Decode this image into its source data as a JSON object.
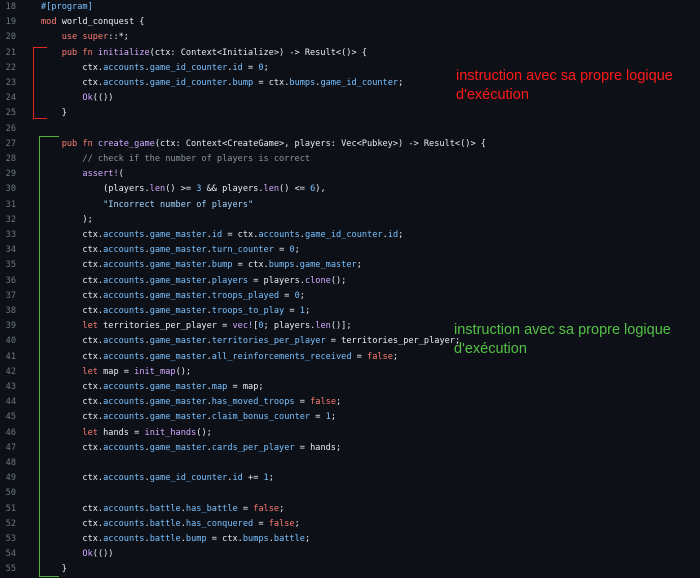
{
  "colors": {
    "background": "#0d1117",
    "line_number": "#6e7681",
    "keyword": "#ff7b72",
    "function": "#d2a8ff",
    "property": "#79c0ff",
    "string": "#a5d6ff",
    "comment": "#8b949e",
    "red_annotation": "#ff1a1a",
    "green_annotation": "#55c046"
  },
  "annotations": {
    "red": "instruction avec sa propre logique d'exécution",
    "green": "instruction avec sa propre logique d'exécution"
  },
  "lines": [
    {
      "n": "18",
      "tokens": [
        [
          "attr",
          "#[program]"
        ]
      ]
    },
    {
      "n": "19",
      "tokens": [
        [
          "kw",
          "mod "
        ],
        [
          "plain",
          "world_conquest {"
        ]
      ]
    },
    {
      "n": "20",
      "tokens": [
        [
          "plain",
          "    "
        ],
        [
          "kw",
          "use "
        ],
        [
          "kw",
          "super"
        ],
        [
          "plain",
          "::*;"
        ]
      ]
    },
    {
      "n": "21",
      "tokens": [
        [
          "plain",
          "    "
        ],
        [
          "kw",
          "pub fn "
        ],
        [
          "fn",
          "initialize"
        ],
        [
          "plain",
          "(ctx: Context<Initialize>) -> Result<()> {"
        ]
      ]
    },
    {
      "n": "22",
      "tokens": [
        [
          "plain",
          "        ctx."
        ],
        [
          "prop",
          "accounts"
        ],
        [
          "plain",
          "."
        ],
        [
          "prop",
          "game_id_counter"
        ],
        [
          "plain",
          "."
        ],
        [
          "prop",
          "id"
        ],
        [
          "plain",
          " = "
        ],
        [
          "num",
          "0"
        ],
        [
          "plain",
          ";"
        ]
      ]
    },
    {
      "n": "23",
      "tokens": [
        [
          "plain",
          "        ctx."
        ],
        [
          "prop",
          "accounts"
        ],
        [
          "plain",
          "."
        ],
        [
          "prop",
          "game_id_counter"
        ],
        [
          "plain",
          "."
        ],
        [
          "prop",
          "bump"
        ],
        [
          "plain",
          " = ctx."
        ],
        [
          "prop",
          "bumps"
        ],
        [
          "plain",
          "."
        ],
        [
          "prop",
          "game_id_counter"
        ],
        [
          "plain",
          ";"
        ]
      ]
    },
    {
      "n": "24",
      "tokens": [
        [
          "plain",
          "        "
        ],
        [
          "fn",
          "Ok"
        ],
        [
          "plain",
          "(())"
        ]
      ]
    },
    {
      "n": "25",
      "tokens": [
        [
          "plain",
          "    }"
        ]
      ]
    },
    {
      "n": "26",
      "tokens": []
    },
    {
      "n": "27",
      "tokens": [
        [
          "plain",
          "    "
        ],
        [
          "kw",
          "pub fn "
        ],
        [
          "fn",
          "create_game"
        ],
        [
          "plain",
          "(ctx: Context<CreateGame>, players: Vec<Pubkey>) -> Result<()> {"
        ]
      ]
    },
    {
      "n": "28",
      "tokens": [
        [
          "plain",
          "        "
        ],
        [
          "cm",
          "// check if the number of players is correct"
        ]
      ]
    },
    {
      "n": "29",
      "tokens": [
        [
          "plain",
          "        "
        ],
        [
          "macro",
          "assert!"
        ],
        [
          "plain",
          "("
        ]
      ]
    },
    {
      "n": "30",
      "tokens": [
        [
          "plain",
          "            (players."
        ],
        [
          "fn",
          "len"
        ],
        [
          "plain",
          "() >= "
        ],
        [
          "num",
          "3"
        ],
        [
          "plain",
          " && players."
        ],
        [
          "fn",
          "len"
        ],
        [
          "plain",
          "() <= "
        ],
        [
          "num",
          "6"
        ],
        [
          "plain",
          "),"
        ]
      ]
    },
    {
      "n": "31",
      "tokens": [
        [
          "plain",
          "            "
        ],
        [
          "str",
          "\"Incorrect number of players\""
        ]
      ]
    },
    {
      "n": "32",
      "tokens": [
        [
          "plain",
          "        );"
        ]
      ]
    },
    {
      "n": "33",
      "tokens": [
        [
          "plain",
          "        ctx."
        ],
        [
          "prop",
          "accounts"
        ],
        [
          "plain",
          "."
        ],
        [
          "prop",
          "game_master"
        ],
        [
          "plain",
          "."
        ],
        [
          "prop",
          "id"
        ],
        [
          "plain",
          " = ctx."
        ],
        [
          "prop",
          "accounts"
        ],
        [
          "plain",
          "."
        ],
        [
          "prop",
          "game_id_counter"
        ],
        [
          "plain",
          "."
        ],
        [
          "prop",
          "id"
        ],
        [
          "plain",
          ";"
        ]
      ]
    },
    {
      "n": "34",
      "tokens": [
        [
          "plain",
          "        ctx."
        ],
        [
          "prop",
          "accounts"
        ],
        [
          "plain",
          "."
        ],
        [
          "prop",
          "game_master"
        ],
        [
          "plain",
          "."
        ],
        [
          "prop",
          "turn_counter"
        ],
        [
          "plain",
          " = "
        ],
        [
          "num",
          "0"
        ],
        [
          "plain",
          ";"
        ]
      ]
    },
    {
      "n": "35",
      "tokens": [
        [
          "plain",
          "        ctx."
        ],
        [
          "prop",
          "accounts"
        ],
        [
          "plain",
          "."
        ],
        [
          "prop",
          "game_master"
        ],
        [
          "plain",
          "."
        ],
        [
          "prop",
          "bump"
        ],
        [
          "plain",
          " = ctx."
        ],
        [
          "prop",
          "bumps"
        ],
        [
          "plain",
          "."
        ],
        [
          "prop",
          "game_master"
        ],
        [
          "plain",
          ";"
        ]
      ]
    },
    {
      "n": "36",
      "tokens": [
        [
          "plain",
          "        ctx."
        ],
        [
          "prop",
          "accounts"
        ],
        [
          "plain",
          "."
        ],
        [
          "prop",
          "game_master"
        ],
        [
          "plain",
          "."
        ],
        [
          "prop",
          "players"
        ],
        [
          "plain",
          " = players."
        ],
        [
          "fn",
          "clone"
        ],
        [
          "plain",
          "();"
        ]
      ]
    },
    {
      "n": "37",
      "tokens": [
        [
          "plain",
          "        ctx."
        ],
        [
          "prop",
          "accounts"
        ],
        [
          "plain",
          "."
        ],
        [
          "prop",
          "game_master"
        ],
        [
          "plain",
          "."
        ],
        [
          "prop",
          "troops_played"
        ],
        [
          "plain",
          " = "
        ],
        [
          "num",
          "0"
        ],
        [
          "plain",
          ";"
        ]
      ]
    },
    {
      "n": "38",
      "tokens": [
        [
          "plain",
          "        ctx."
        ],
        [
          "prop",
          "accounts"
        ],
        [
          "plain",
          "."
        ],
        [
          "prop",
          "game_master"
        ],
        [
          "plain",
          "."
        ],
        [
          "prop",
          "troops_to_play"
        ],
        [
          "plain",
          " = "
        ],
        [
          "num",
          "1"
        ],
        [
          "plain",
          ";"
        ]
      ]
    },
    {
      "n": "39",
      "tokens": [
        [
          "plain",
          "        "
        ],
        [
          "kw",
          "let "
        ],
        [
          "plain",
          "territories_per_player = "
        ],
        [
          "macro",
          "vec!"
        ],
        [
          "plain",
          "["
        ],
        [
          "num",
          "0"
        ],
        [
          "plain",
          "; players."
        ],
        [
          "fn",
          "len"
        ],
        [
          "plain",
          "()];"
        ]
      ]
    },
    {
      "n": "40",
      "tokens": [
        [
          "plain",
          "        ctx."
        ],
        [
          "prop",
          "accounts"
        ],
        [
          "plain",
          "."
        ],
        [
          "prop",
          "game_master"
        ],
        [
          "plain",
          "."
        ],
        [
          "prop",
          "territories_per_player"
        ],
        [
          "plain",
          " = territories_per_player;"
        ]
      ]
    },
    {
      "n": "41",
      "tokens": [
        [
          "plain",
          "        ctx."
        ],
        [
          "prop",
          "accounts"
        ],
        [
          "plain",
          "."
        ],
        [
          "prop",
          "game_master"
        ],
        [
          "plain",
          "."
        ],
        [
          "prop",
          "all_reinforcements_received"
        ],
        [
          "plain",
          " = "
        ],
        [
          "kw",
          "false"
        ],
        [
          "plain",
          ";"
        ]
      ]
    },
    {
      "n": "42",
      "tokens": [
        [
          "plain",
          "        "
        ],
        [
          "kw",
          "let "
        ],
        [
          "plain",
          "map = "
        ],
        [
          "fn",
          "init_map"
        ],
        [
          "plain",
          "();"
        ]
      ]
    },
    {
      "n": "43",
      "tokens": [
        [
          "plain",
          "        ctx."
        ],
        [
          "prop",
          "accounts"
        ],
        [
          "plain",
          "."
        ],
        [
          "prop",
          "game_master"
        ],
        [
          "plain",
          "."
        ],
        [
          "prop",
          "map"
        ],
        [
          "plain",
          " = map;"
        ]
      ]
    },
    {
      "n": "44",
      "tokens": [
        [
          "plain",
          "        ctx."
        ],
        [
          "prop",
          "accounts"
        ],
        [
          "plain",
          "."
        ],
        [
          "prop",
          "game_master"
        ],
        [
          "plain",
          "."
        ],
        [
          "prop",
          "has_moved_troops"
        ],
        [
          "plain",
          " = "
        ],
        [
          "kw",
          "false"
        ],
        [
          "plain",
          ";"
        ]
      ]
    },
    {
      "n": "45",
      "tokens": [
        [
          "plain",
          "        ctx."
        ],
        [
          "prop",
          "accounts"
        ],
        [
          "plain",
          "."
        ],
        [
          "prop",
          "game_master"
        ],
        [
          "plain",
          "."
        ],
        [
          "prop",
          "claim_bonus_counter"
        ],
        [
          "plain",
          " = "
        ],
        [
          "num",
          "1"
        ],
        [
          "plain",
          ";"
        ]
      ]
    },
    {
      "n": "46",
      "tokens": [
        [
          "plain",
          "        "
        ],
        [
          "kw",
          "let "
        ],
        [
          "plain",
          "hands = "
        ],
        [
          "fn",
          "init_hands"
        ],
        [
          "plain",
          "();"
        ]
      ]
    },
    {
      "n": "47",
      "tokens": [
        [
          "plain",
          "        ctx."
        ],
        [
          "prop",
          "accounts"
        ],
        [
          "plain",
          "."
        ],
        [
          "prop",
          "game_master"
        ],
        [
          "plain",
          "."
        ],
        [
          "prop",
          "cards_per_player"
        ],
        [
          "plain",
          " = hands;"
        ]
      ]
    },
    {
      "n": "48",
      "tokens": []
    },
    {
      "n": "49",
      "tokens": [
        [
          "plain",
          "        ctx."
        ],
        [
          "prop",
          "accounts"
        ],
        [
          "plain",
          "."
        ],
        [
          "prop",
          "game_id_counter"
        ],
        [
          "plain",
          "."
        ],
        [
          "prop",
          "id"
        ],
        [
          "plain",
          " += "
        ],
        [
          "num",
          "1"
        ],
        [
          "plain",
          ";"
        ]
      ]
    },
    {
      "n": "50",
      "tokens": []
    },
    {
      "n": "51",
      "tokens": [
        [
          "plain",
          "        ctx."
        ],
        [
          "prop",
          "accounts"
        ],
        [
          "plain",
          "."
        ],
        [
          "prop",
          "battle"
        ],
        [
          "plain",
          "."
        ],
        [
          "prop",
          "has_battle"
        ],
        [
          "plain",
          " = "
        ],
        [
          "kw",
          "false"
        ],
        [
          "plain",
          ";"
        ]
      ]
    },
    {
      "n": "52",
      "tokens": [
        [
          "plain",
          "        ctx."
        ],
        [
          "prop",
          "accounts"
        ],
        [
          "plain",
          "."
        ],
        [
          "prop",
          "battle"
        ],
        [
          "plain",
          "."
        ],
        [
          "prop",
          "has_conquered"
        ],
        [
          "plain",
          " = "
        ],
        [
          "kw",
          "false"
        ],
        [
          "plain",
          ";"
        ]
      ]
    },
    {
      "n": "53",
      "tokens": [
        [
          "plain",
          "        ctx."
        ],
        [
          "prop",
          "accounts"
        ],
        [
          "plain",
          "."
        ],
        [
          "prop",
          "battle"
        ],
        [
          "plain",
          "."
        ],
        [
          "prop",
          "bump"
        ],
        [
          "plain",
          " = ctx."
        ],
        [
          "prop",
          "bumps"
        ],
        [
          "plain",
          "."
        ],
        [
          "prop",
          "battle"
        ],
        [
          "plain",
          ";"
        ]
      ]
    },
    {
      "n": "54",
      "tokens": [
        [
          "plain",
          "        "
        ],
        [
          "fn",
          "Ok"
        ],
        [
          "plain",
          "(())"
        ]
      ]
    },
    {
      "n": "55",
      "tokens": [
        [
          "plain",
          "    }"
        ]
      ]
    }
  ]
}
